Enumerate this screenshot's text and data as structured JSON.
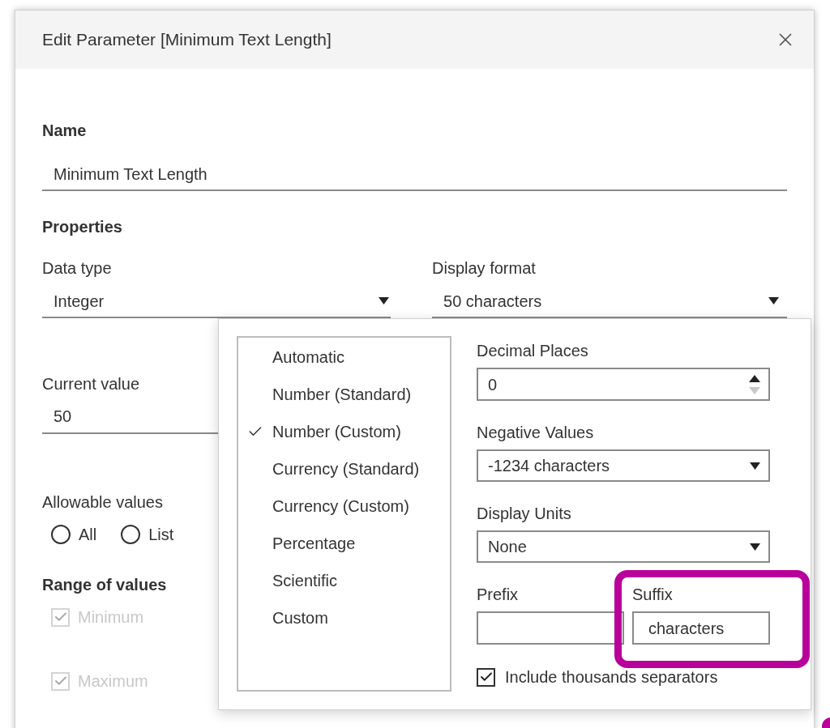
{
  "dialog": {
    "title": "Edit Parameter [Minimum Text Length]"
  },
  "name": {
    "label": "Name",
    "value": "Minimum Text Length"
  },
  "properties": {
    "heading": "Properties",
    "data_type": {
      "label": "Data type",
      "value": "Integer"
    },
    "display_format": {
      "label": "Display format",
      "value": "50 characters"
    }
  },
  "current_value": {
    "label": "Current value",
    "value": "50"
  },
  "allowable_values": {
    "label": "Allowable values",
    "options": [
      {
        "label": "All",
        "selected": false
      },
      {
        "label": "List",
        "selected": false
      }
    ]
  },
  "range": {
    "heading": "Range of values",
    "options": [
      {
        "label": "Minimum",
        "checked": true,
        "disabled": true
      },
      {
        "label": "Maximum",
        "checked": true,
        "disabled": true
      }
    ]
  },
  "format_popup": {
    "formats": [
      {
        "label": "Automatic",
        "selected": false
      },
      {
        "label": "Number (Standard)",
        "selected": false
      },
      {
        "label": "Number (Custom)",
        "selected": true
      },
      {
        "label": "Currency (Standard)",
        "selected": false
      },
      {
        "label": "Currency (Custom)",
        "selected": false
      },
      {
        "label": "Percentage",
        "selected": false
      },
      {
        "label": "Scientific",
        "selected": false
      },
      {
        "label": "Custom",
        "selected": false
      }
    ],
    "decimal_places": {
      "label": "Decimal Places",
      "value": "0"
    },
    "negative_values": {
      "label": "Negative Values",
      "value": "-1234 characters"
    },
    "display_units": {
      "label": "Display Units",
      "value": "None"
    },
    "prefix": {
      "label": "Prefix"
    },
    "suffix": {
      "label": "Suffix",
      "value": "characters"
    },
    "thousands_separators": {
      "label": "Include thousands separators",
      "checked": true
    }
  }
}
